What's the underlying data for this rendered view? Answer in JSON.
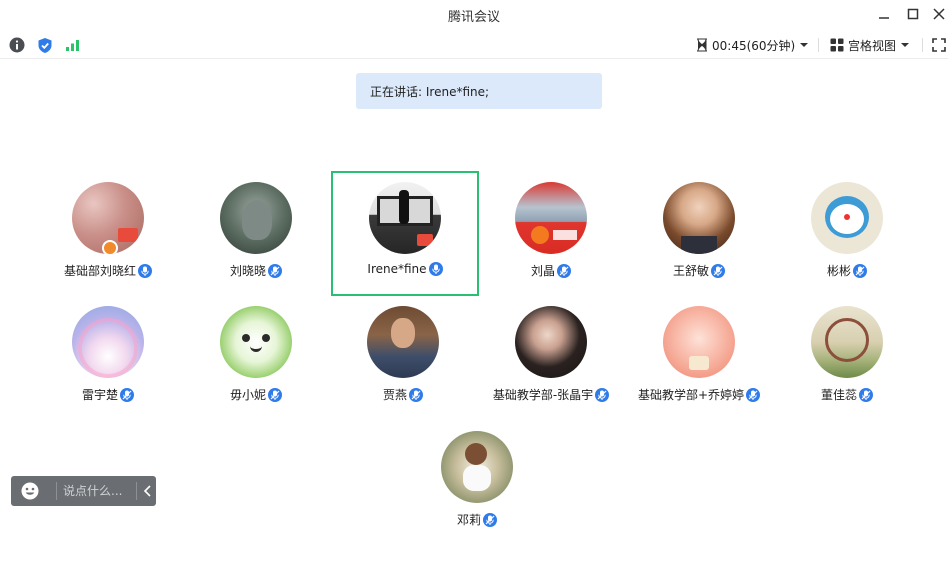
{
  "window": {
    "title": "腾讯会议"
  },
  "toolbar": {
    "timer": "00:45(60分钟)",
    "view_label": "宫格视图"
  },
  "speaking": {
    "label": "正在讲话:",
    "names": "Irene*fine;"
  },
  "participants": [
    {
      "name": "基础部刘晓红",
      "mic": "on",
      "host": true
    },
    {
      "name": "刘晓晓",
      "mic": "muted"
    },
    {
      "name": "Irene*fine",
      "mic": "on",
      "active": true
    },
    {
      "name": "刘晶",
      "mic": "muted"
    },
    {
      "name": "王舒敏",
      "mic": "muted"
    },
    {
      "name": "彬彬",
      "mic": "muted"
    },
    {
      "name": "雷宇楚",
      "mic": "muted"
    },
    {
      "name": "毋小妮",
      "mic": "muted"
    },
    {
      "name": "贾燕",
      "mic": "muted"
    },
    {
      "name": "基础教学部-张晶宇",
      "mic": "muted"
    },
    {
      "name": "基础教学部+乔婷婷",
      "mic": "muted"
    },
    {
      "name": "董佳蕊",
      "mic": "muted"
    },
    {
      "name": "邓莉",
      "mic": "muted"
    }
  ],
  "chat": {
    "placeholder": "说点什么..."
  },
  "colors": {
    "accent": "#2f7bea",
    "active_border": "#2bbf73",
    "banner_bg": "#dbe9fb",
    "signal": "#29c36a"
  }
}
